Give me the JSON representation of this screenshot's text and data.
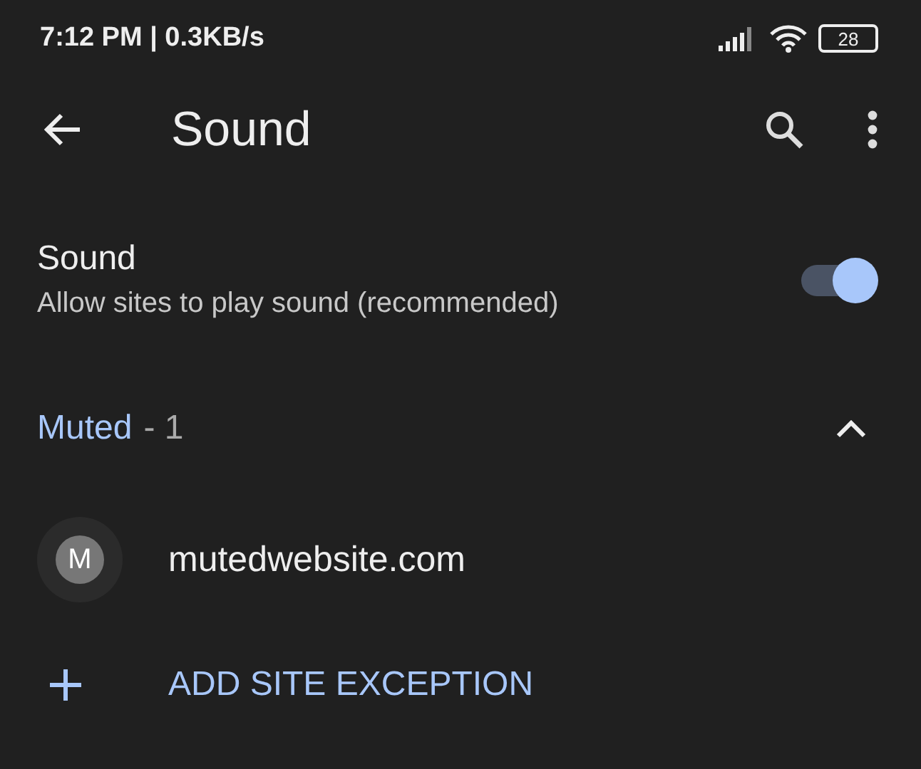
{
  "status_bar": {
    "time": "7:12 PM | 0.3KB/s",
    "battery": "28"
  },
  "toolbar": {
    "title": "Sound"
  },
  "setting": {
    "title": "Sound",
    "subtitle": "Allow sites to play sound (recommended)",
    "on": true
  },
  "section": {
    "label": "Muted",
    "count": "- 1",
    "expanded": true
  },
  "sites": [
    {
      "initial": "M",
      "name": "mutedwebsite.com"
    }
  ],
  "add_button": {
    "label": "ADD SITE EXCEPTION"
  }
}
